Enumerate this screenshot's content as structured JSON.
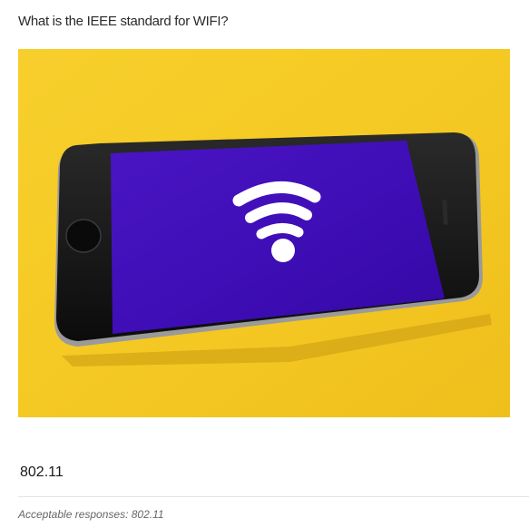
{
  "question": {
    "text": "What is the IEEE standard for WIFI?"
  },
  "image": {
    "icon": "wifi-icon",
    "colors": {
      "background": "#f5c923",
      "phone_body": "#141414",
      "screen": "#3f0fb8",
      "wifi_symbol": "#ffffff"
    }
  },
  "answer": {
    "value": "802.11"
  },
  "acceptable": {
    "label": "Acceptable responses:",
    "value": "802.11"
  }
}
